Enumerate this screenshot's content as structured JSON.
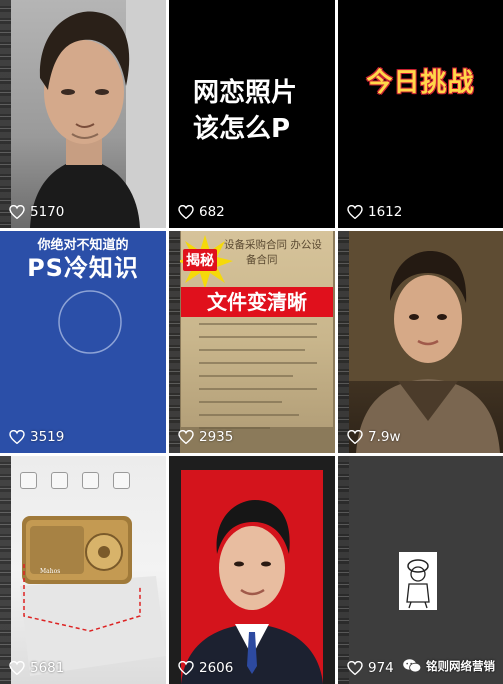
{
  "grid": {
    "tiles": [
      {
        "id": "t1",
        "likes": "5170"
      },
      {
        "id": "t2",
        "likes": "682",
        "title_line1": "网恋照片",
        "title_line2": "该怎么P"
      },
      {
        "id": "t3",
        "likes": "1612",
        "title": "今日挑战"
      },
      {
        "id": "t4",
        "likes": "3519",
        "subtitle": "你绝对不知道的",
        "title": "PS冷知识"
      },
      {
        "id": "t5",
        "likes": "2935",
        "badge": "揭秘",
        "doc_head_1": "设备采购合同 办公设",
        "doc_head_2": "备合同",
        "banner": "文件变清晰"
      },
      {
        "id": "t6",
        "likes": "7.9w"
      },
      {
        "id": "t7",
        "likes": "5681",
        "radio_label": "Mahos"
      },
      {
        "id": "t8",
        "likes": "2606"
      },
      {
        "id": "t9",
        "likes": "974"
      }
    ]
  },
  "watermark": "铭则网络营销",
  "colors": {
    "blue_tile": "#2b4fa8",
    "banner_red": "#e0101c",
    "id_photo_red": "#d4141c",
    "challenge_yellow": "#ffd74a"
  }
}
